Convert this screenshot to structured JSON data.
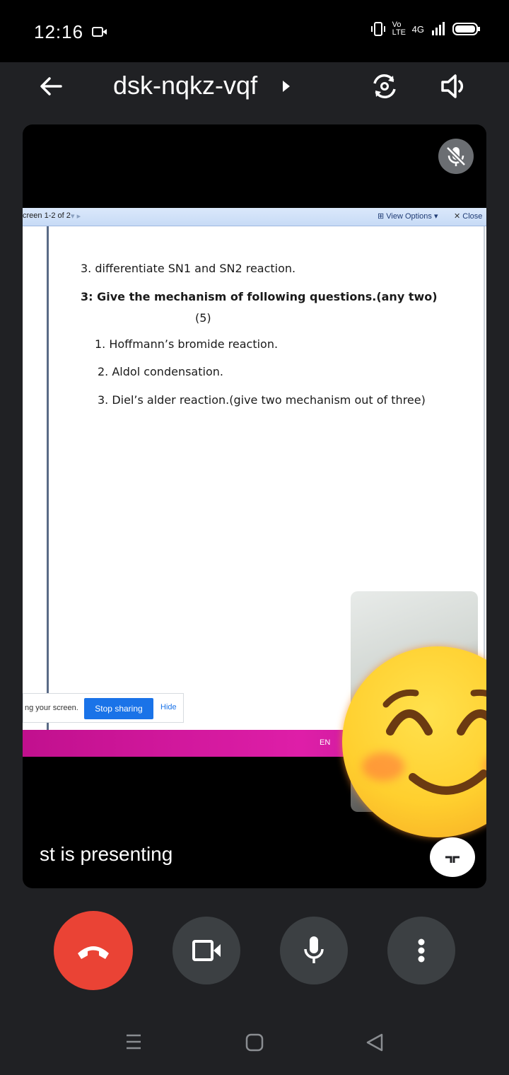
{
  "status_bar": {
    "time": "12:16",
    "network": "4G",
    "volte": "Vo LTE"
  },
  "header": {
    "meeting_code": "dsk-nqkz-vqf"
  },
  "presentation": {
    "viewer_bar": {
      "screen_label": "creen 1-2 of 2",
      "view_options": "View Options",
      "close": "Close"
    },
    "document_lines": [
      "3. differentiate SN1 and SN2 reaction.",
      "3: Give the mechanism of  following questions.(any two)",
      "(5)",
      "1. Hoffmann’s bromide reaction.",
      "2. Aldol condensation.",
      "3. Diel’s alder reaction.(give two mechanism out of three)"
    ],
    "share_banner": {
      "text": "ng your screen.",
      "stop_label": "Stop sharing",
      "hide_label": "Hide"
    },
    "taskbar": {
      "language": "EN"
    },
    "presenting_label": "st is presenting"
  },
  "colors": {
    "end_call": "#ea4335",
    "stop_sharing": "#1a73e8",
    "taskbar": "#d21a9e",
    "control_bg": "#3c4043"
  },
  "icons": {
    "back": "arrow-left-icon",
    "switch_camera": "switch-camera-icon",
    "speaker": "speaker-icon",
    "mic_off": "mic-off-icon",
    "end_call": "phone-hangup-icon",
    "video": "video-camera-icon",
    "mic": "mic-icon",
    "more": "more-vertical-icon"
  }
}
